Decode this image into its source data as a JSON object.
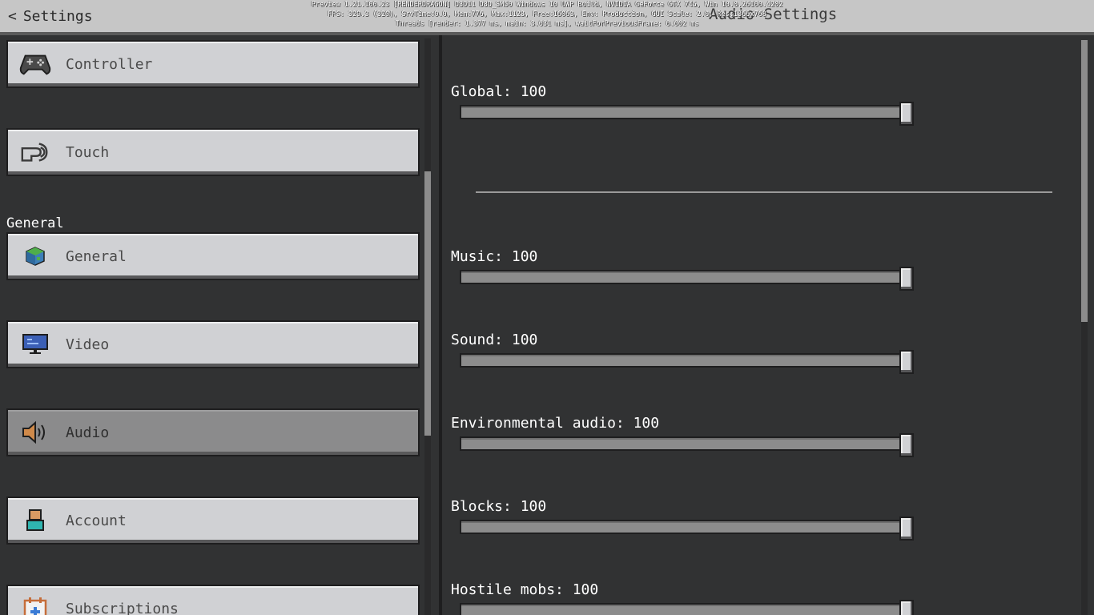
{
  "header": {
    "back_label": "Settings",
    "title": "Audio Settings",
    "debug_lines": [
      "Preview 1.21.100.23 [RENDERDRAGON] D3D11 D3D_SM50 Windows 10 UWP Build, NVIDIA GeForce GTX 745, Win 10.0.26100.4202",
      "FPS: 329.3 (320), SrvTime:0.0, Mem:776, Max:1123, Free:16063, Env: Production, GUI Scale: 2.0, Res:1366x768",
      "Threads [render: 1.377 ms, main: 3.031 ms], waitForPreviousFrame: 0.002 ms"
    ]
  },
  "sidebar": {
    "section_general": "General",
    "items": [
      {
        "label": "Controller",
        "icon": "controller-icon",
        "selected": false
      },
      {
        "label": "Touch",
        "icon": "touch-icon",
        "selected": false
      },
      {
        "label": "General",
        "icon": "globe-cube-icon",
        "selected": false
      },
      {
        "label": "Video",
        "icon": "monitor-icon",
        "selected": false
      },
      {
        "label": "Audio",
        "icon": "speaker-icon",
        "selected": true
      },
      {
        "label": "Account",
        "icon": "person-icon",
        "selected": false
      },
      {
        "label": "Subscriptions",
        "icon": "calendar-plus-icon",
        "selected": false
      }
    ]
  },
  "sliders": [
    {
      "label": "Global: 100",
      "value": 100
    },
    {
      "label": "Music: 100",
      "value": 100
    },
    {
      "label": "Sound: 100",
      "value": 100
    },
    {
      "label": "Environmental audio: 100",
      "value": 100
    },
    {
      "label": "Blocks: 100",
      "value": 100
    },
    {
      "label": "Hostile mobs: 100",
      "value": 100
    }
  ],
  "colors": {
    "background": "#313233",
    "button": "#d0d1d4",
    "button_selected": "#8b8b8c",
    "header": "#c6c6c6"
  }
}
